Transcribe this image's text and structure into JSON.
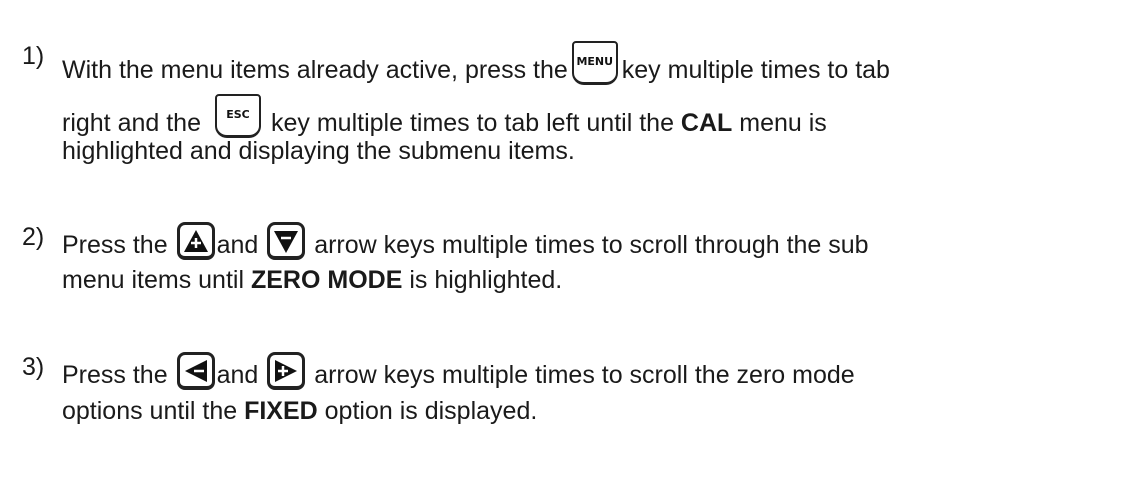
{
  "steps": [
    {
      "number": "1)",
      "line1_a": "With the menu items already active, press the",
      "key_menu": "MENU",
      "line1_b": "key multiple times to tab",
      "line2_a": "right and the",
      "key_esc": "ESC",
      "line2_b": "key multiple times to tab left until the",
      "line2_bold": "CAL",
      "line2_c": "menu is",
      "line3": "highlighted and displaying the submenu items."
    },
    {
      "number": "2)",
      "line1_a": "Press the",
      "line1_and": "and",
      "line1_b": "arrow keys multiple times to scroll through the sub",
      "line2_a": "menu items until",
      "line2_bold": "ZERO MODE",
      "line2_b": "is highlighted."
    },
    {
      "number": "3)",
      "line1_a": "Press the",
      "line1_and": "and",
      "line1_b": "arrow keys multiple times to scroll the zero mode",
      "line2_a": "options until the",
      "line2_bold": "FIXED",
      "line2_b": "option is displayed."
    }
  ],
  "icons": {
    "up": "up-arrow-key-icon",
    "down": "down-arrow-key-icon",
    "left": "left-arrow-key-icon",
    "right": "right-arrow-key-icon"
  }
}
